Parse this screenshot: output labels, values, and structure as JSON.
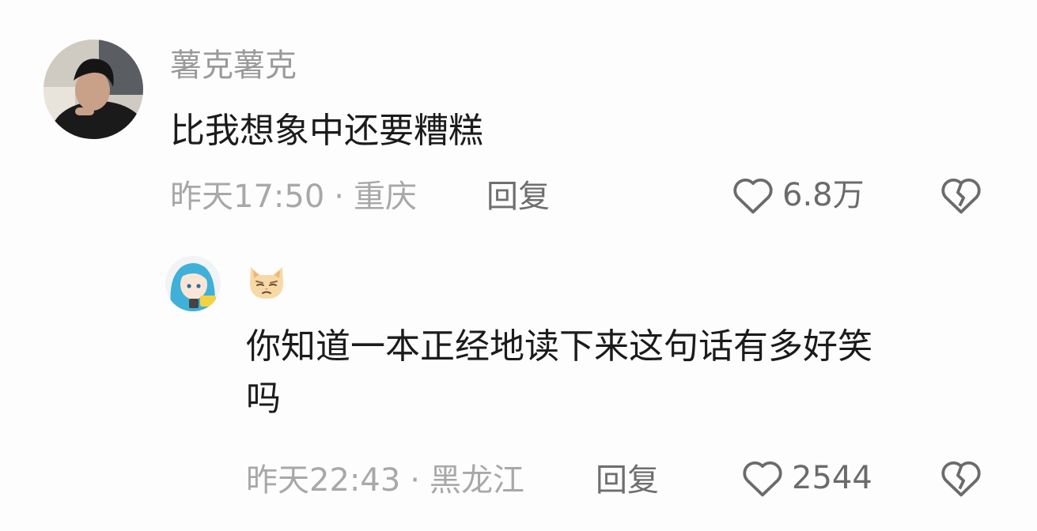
{
  "comments": [
    {
      "username": "薯克薯克",
      "text": "比我想象中还要糟糕",
      "time": "昨天17:50",
      "location": "重庆",
      "reply_label": "回复",
      "likes": "6.8万"
    },
    {
      "username_icon": "cat-emoji-icon",
      "text_line1": "你知道一本正经地读下来这句话有多好笑",
      "text_line2": "吗",
      "time": "昨天22:43",
      "location": "黑龙江",
      "reply_label": "回复",
      "likes": "2544"
    }
  ],
  "separator": "·",
  "icons": {
    "like": "heart-outline-icon",
    "dislike": "broken-heart-icon"
  }
}
